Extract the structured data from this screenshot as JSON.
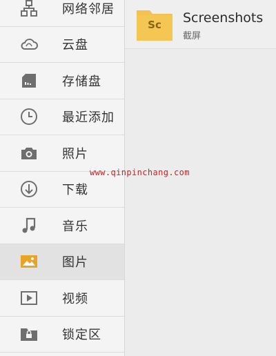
{
  "sidebar": {
    "items": [
      {
        "label": "网络邻居",
        "icon": "network-icon"
      },
      {
        "label": "云盘",
        "icon": "cloud-icon"
      },
      {
        "label": "存储盘",
        "icon": "sd-card-icon"
      },
      {
        "label": "最近添加",
        "icon": "clock-icon"
      },
      {
        "label": "照片",
        "icon": "camera-icon"
      },
      {
        "label": "下载",
        "icon": "download-icon"
      },
      {
        "label": "音乐",
        "icon": "music-icon"
      },
      {
        "label": "图片",
        "icon": "image-icon",
        "active": true
      },
      {
        "label": "视频",
        "icon": "video-icon"
      },
      {
        "label": "锁定区",
        "icon": "lock-folder-icon"
      }
    ]
  },
  "main": {
    "folders": [
      {
        "icon_text": "Sc",
        "name": "Screenshots",
        "subtitle": "截屏"
      }
    ]
  },
  "watermark": "www.qinpinchang.com",
  "colors": {
    "icon_gray": "#6e6e6e",
    "icon_active": "#e8a427",
    "folder_yellow": "#f2c14e",
    "watermark_red": "#cc2020"
  }
}
